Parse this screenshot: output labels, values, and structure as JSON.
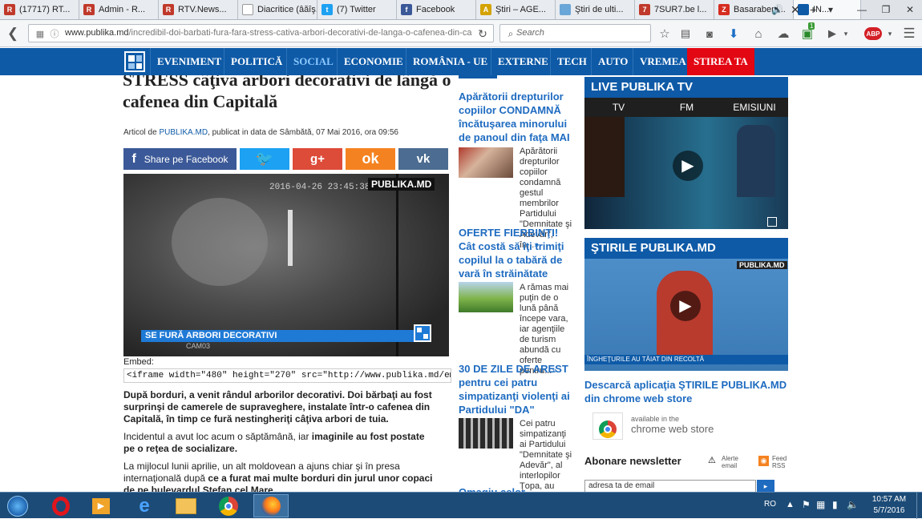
{
  "browser": {
    "tabs": [
      {
        "label": "(17717) RT...",
        "icon": "rtv-icon",
        "color": "#c0392b",
        "glyph": "R"
      },
      {
        "label": "Admin - R...",
        "icon": "r-logo-icon",
        "color": "#c0392b",
        "glyph": "R"
      },
      {
        "label": "RTV.News...",
        "icon": "r-logo-icon",
        "color": "#c0392b",
        "glyph": "R"
      },
      {
        "label": "Diacritice (âăîş...",
        "icon": "page-icon",
        "color": "#ffffff",
        "glyph": ""
      },
      {
        "label": "(7) Twitter",
        "icon": "twitter-icon",
        "color": "#1da1f2",
        "glyph": "t"
      },
      {
        "label": "Facebook",
        "icon": "facebook-icon",
        "color": "#3b5998",
        "glyph": "f"
      },
      {
        "label": "Ştiri – AGE...",
        "icon": "agerpres-icon",
        "color": "#d4a300",
        "glyph": "A"
      },
      {
        "label": "Ştiri de ulti...",
        "icon": "page-icon",
        "color": "#6aa6d8",
        "glyph": ""
      },
      {
        "label": "7SUR7.be l...",
        "icon": "7sur7-icon",
        "color": "#c0392b",
        "glyph": "7"
      },
      {
        "label": "Basarabeni...",
        "icon": "zdg-icon",
        "color": "#d62d20",
        "glyph": "Z"
      }
    ],
    "active_tab": "IN...",
    "url_domain": "www.publika.md",
    "url_path": "/incredibil-doi-barbati-fura-fara-stress-cativa-arbori-decorativi-de-langa-o-cafenea-din-ca",
    "search_placeholder": "Search",
    "badge_count": "1"
  },
  "site": {
    "menu": [
      "EVENIMENT",
      "POLITICĂ",
      "SOCIAL",
      "ECONOMIE",
      "ROMÂNIA - UE",
      "EXTERNE",
      "TECH",
      "AUTO",
      "VREMEA",
      "STIREA TA"
    ]
  },
  "article": {
    "title": "STRESS câţiva arbori decorativi de lângă o cafenea din Capitală",
    "meta_prefix": "Articol de",
    "meta_author": "PUBLIKA.MD",
    "meta_suffix": ", publicat in data de Sâmbătă, 07 Mai 2016, ora 09:56",
    "share_facebook": "Share pe Facebook",
    "video_timestamp": "2016-04-26 23:45:38",
    "video_logo": "PUBLIKA.MD",
    "video_caption": "SE FURĂ ARBORI DECORATIVI",
    "video_cam": "CAM03",
    "embed_label": "Embed:",
    "embed_code": "<iframe width=\"480\" height=\"270\" src=\"http://www.publika.md/embed_iframe.php",
    "p1": "După borduri, a venit rândul arborilor decorativi. Doi bărbaţi au fost surprinşi de camerele de supraveghere, instalate într-o cafenea din Capitală, în timp ce fură nestingheriţi câţiva arbori de tuia.",
    "p2a": "Incidentul a avut loc acum o săptămână, iar ",
    "p2b": "imaginile au fost postate pe o reţea de socializare.",
    "p3a": "La mijlocul lunii aprilie, un alt moldovean a ajuns chiar şi în presa internaţională după ",
    "p3b": "ce a furat mai multe borduri din jurul unor copaci de pe bulevardul Ştefan cel Mare."
  },
  "news": [
    {
      "title": "Apărătorii drepturilor copiilor CONDAMNĂ încătuşarea minorului de panoul din faţa MAI",
      "snippet": "Apărătorii drepturilor copiilor condamnă gestul membrilor Partidului \"Demnitate şi Adevăr\", în...",
      "more": "»"
    },
    {
      "title": "OFERTE FIERBINŢI! Cât costă să îţi trimiţi copilul la o tabără de vară în străinătate",
      "snippet": "A rămas mai puţin de o lună până începe vara, iar agenţiile de turism abundă cu oferte pentru...",
      "more": "»"
    },
    {
      "title": "30 DE ZILE DE AREST pentru cei patru simpatizanţi violenţi ai Partidului \"DA\"",
      "snippet": "Cei patru simpatizanţi ai Partidului \"Demnitate şi Adevăr\", al interlopilor Ţopa, au fost...",
      "more": "»"
    },
    {
      "title": "Omagiu celor"
    }
  ],
  "sidebar": {
    "live_title": "LIVE PUBLIKA TV",
    "live_tabs": [
      "TV",
      "FM",
      "EMISIUNI"
    ],
    "stiri_title": "ŞTIRILE PUBLIKA.MD",
    "stiri_logo": "PUBLIKA.MD",
    "stiri_ticker": "ÎNGHEŢURILE AU TĂIAT DIN RECOLTĂ",
    "download_text": "Descarcă aplicaţia ŞTIRILE PUBLIKA.MD din chrome web store",
    "store_small": "available in the",
    "store_big": "chrome web store",
    "newsletter_title": "Abonare newsletter",
    "alerts_label": "Alerte email",
    "rss_label": "Feed RSS",
    "email_placeholder": "adresa ta de email"
  },
  "taskbar": {
    "lang": "RO",
    "time": "10:57 AM",
    "date": "5/7/2016"
  },
  "colors": {
    "brand": "#0e5aa7",
    "accent_red": "#e30613",
    "link": "#1e6bc0"
  }
}
